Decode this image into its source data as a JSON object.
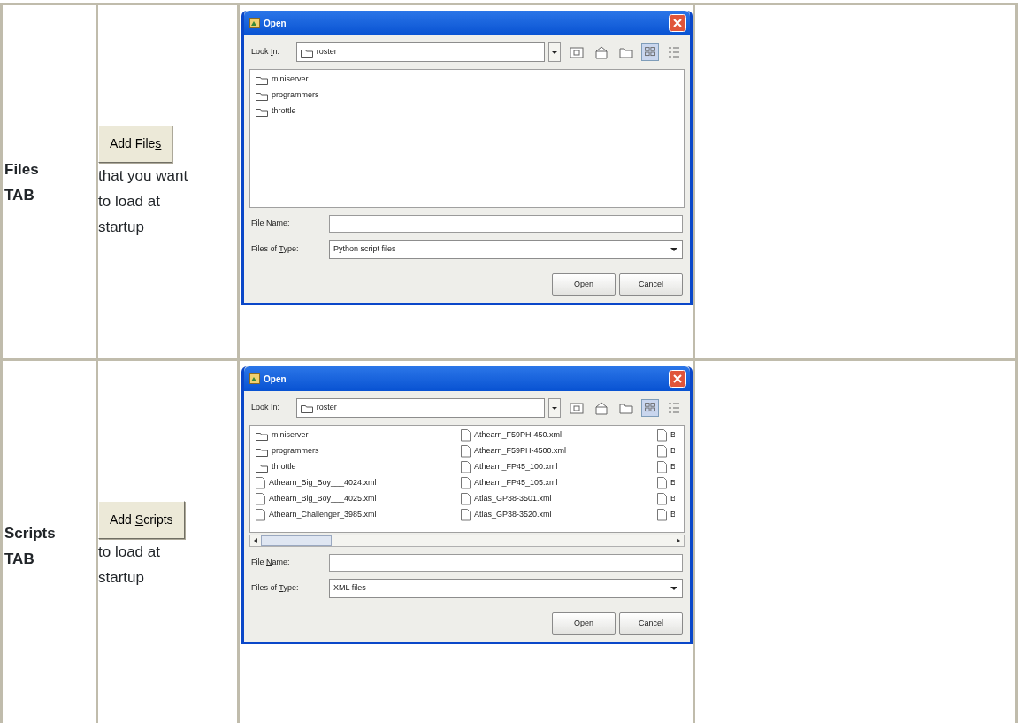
{
  "rows": [
    {
      "tab_label": "Files TAB",
      "button": {
        "before": "Add File",
        "key": "s"
      },
      "caption": "that you want to load at startup",
      "dialog": {
        "title": "Open",
        "look_in_label": {
          "before": "Look ",
          "key": "I",
          "after": "n:"
        },
        "look_in_value": "roster",
        "view_buttons": [
          {
            "kind": "list",
            "selected": true
          },
          {
            "kind": "details",
            "selected": false
          }
        ],
        "horizontal_scrollbar": false,
        "file_columns": [
          {
            "files": [
              {
                "name": "miniserver",
                "kind": "folder"
              },
              {
                "name": "programmers",
                "kind": "folder"
              },
              {
                "name": "throttle",
                "kind": "folder"
              }
            ]
          }
        ],
        "file_name_label": {
          "before": "File ",
          "key": "N",
          "after": "ame:"
        },
        "file_type_label": {
          "before": "Files of ",
          "key": "T",
          "after": "ype:"
        },
        "file_type_value": "Python script files",
        "buttons": [
          "Open",
          "Cancel"
        ]
      }
    },
    {
      "tab_label": "Scripts TAB",
      "button": {
        "before": "Add ",
        "key": "S",
        "after": "cripts"
      },
      "caption": "to load at startup",
      "dialog": {
        "title": "Open",
        "look_in_label": {
          "before": "Look ",
          "key": "I",
          "after": "n:"
        },
        "look_in_value": "roster",
        "view_buttons": [
          {
            "kind": "list",
            "selected": true
          },
          {
            "kind": "details",
            "selected": false
          }
        ],
        "horizontal_scrollbar": true,
        "file_columns": [
          {
            "files": [
              {
                "name": "miniserver",
                "kind": "folder"
              },
              {
                "name": "programmers",
                "kind": "folder"
              },
              {
                "name": "throttle",
                "kind": "folder"
              },
              {
                "name": "Athearn_Big_Boy___4024.xml",
                "kind": "file"
              },
              {
                "name": "Athearn_Big_Boy___4025.xml",
                "kind": "file"
              },
              {
                "name": "Athearn_Challenger_3985.xml",
                "kind": "file"
              }
            ]
          },
          {
            "files": [
              {
                "name": "Athearn_F59PH-450.xml",
                "kind": "file"
              },
              {
                "name": "Athearn_F59PH-4500.xml",
                "kind": "file"
              },
              {
                "name": "Athearn_FP45_100.xml",
                "kind": "file"
              },
              {
                "name": "Athearn_FP45_105.xml",
                "kind": "file"
              },
              {
                "name": "Atlas_GP38-3501.xml",
                "kind": "file"
              },
              {
                "name": "Atlas_GP38-3520.xml",
                "kind": "file"
              }
            ]
          },
          {
            "files": [
              {
                "name": "B",
                "kind": "file"
              },
              {
                "name": "B",
                "kind": "file"
              },
              {
                "name": "B",
                "kind": "file"
              },
              {
                "name": "B",
                "kind": "file"
              },
              {
                "name": "B",
                "kind": "file"
              },
              {
                "name": "B",
                "kind": "file"
              }
            ]
          }
        ],
        "file_name_label": {
          "before": "File ",
          "key": "N",
          "after": "ame:"
        },
        "file_type_label": {
          "before": "Files of ",
          "key": "T",
          "after": "ype:"
        },
        "file_type_value": "XML files",
        "buttons": [
          "Open",
          "Cancel"
        ]
      }
    }
  ]
}
